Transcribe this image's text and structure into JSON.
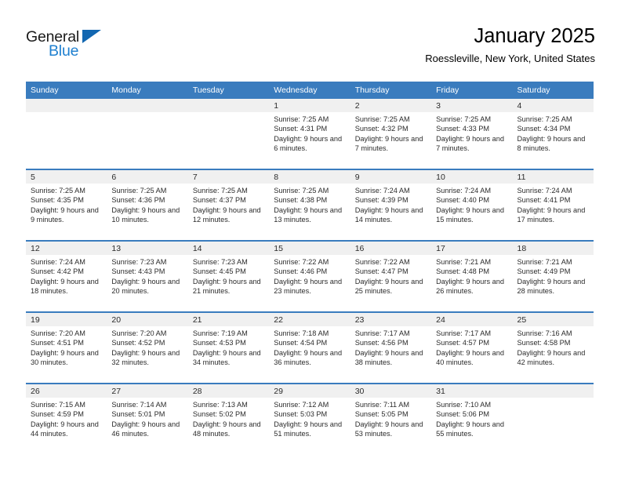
{
  "brand": {
    "name_part1": "General",
    "name_part2": "Blue",
    "triangle_icon": "triangle-icon",
    "accent_color": "#1f80d0",
    "triangle_color": "#1267b1"
  },
  "header": {
    "title": "January 2025",
    "subtitle": "Roessleville, New York, United States"
  },
  "theme": {
    "header_row_bg": "#3a7cbe",
    "daynum_band_bg": "#f0f0f0",
    "row_separator": "#3a7cbe",
    "text_color": "#2b2b2b"
  },
  "weekday_headers": [
    "Sunday",
    "Monday",
    "Tuesday",
    "Wednesday",
    "Thursday",
    "Friday",
    "Saturday"
  ],
  "labels": {
    "sunrise_prefix": "Sunrise:",
    "sunset_prefix": "Sunset:",
    "daylight_prefix": "Daylight:"
  },
  "weeks": [
    [
      {
        "day": "",
        "sunrise": "",
        "sunset": "",
        "daylight": "",
        "empty": true
      },
      {
        "day": "",
        "sunrise": "",
        "sunset": "",
        "daylight": "",
        "empty": true
      },
      {
        "day": "",
        "sunrise": "",
        "sunset": "",
        "daylight": "",
        "empty": true
      },
      {
        "day": "1",
        "sunrise": "Sunrise: 7:25 AM",
        "sunset": "Sunset: 4:31 PM",
        "daylight": "Daylight: 9 hours and 6 minutes."
      },
      {
        "day": "2",
        "sunrise": "Sunrise: 7:25 AM",
        "sunset": "Sunset: 4:32 PM",
        "daylight": "Daylight: 9 hours and 7 minutes."
      },
      {
        "day": "3",
        "sunrise": "Sunrise: 7:25 AM",
        "sunset": "Sunset: 4:33 PM",
        "daylight": "Daylight: 9 hours and 7 minutes."
      },
      {
        "day": "4",
        "sunrise": "Sunrise: 7:25 AM",
        "sunset": "Sunset: 4:34 PM",
        "daylight": "Daylight: 9 hours and 8 minutes."
      }
    ],
    [
      {
        "day": "5",
        "sunrise": "Sunrise: 7:25 AM",
        "sunset": "Sunset: 4:35 PM",
        "daylight": "Daylight: 9 hours and 9 minutes."
      },
      {
        "day": "6",
        "sunrise": "Sunrise: 7:25 AM",
        "sunset": "Sunset: 4:36 PM",
        "daylight": "Daylight: 9 hours and 10 minutes."
      },
      {
        "day": "7",
        "sunrise": "Sunrise: 7:25 AM",
        "sunset": "Sunset: 4:37 PM",
        "daylight": "Daylight: 9 hours and 12 minutes."
      },
      {
        "day": "8",
        "sunrise": "Sunrise: 7:25 AM",
        "sunset": "Sunset: 4:38 PM",
        "daylight": "Daylight: 9 hours and 13 minutes."
      },
      {
        "day": "9",
        "sunrise": "Sunrise: 7:24 AM",
        "sunset": "Sunset: 4:39 PM",
        "daylight": "Daylight: 9 hours and 14 minutes."
      },
      {
        "day": "10",
        "sunrise": "Sunrise: 7:24 AM",
        "sunset": "Sunset: 4:40 PM",
        "daylight": "Daylight: 9 hours and 15 minutes."
      },
      {
        "day": "11",
        "sunrise": "Sunrise: 7:24 AM",
        "sunset": "Sunset: 4:41 PM",
        "daylight": "Daylight: 9 hours and 17 minutes."
      }
    ],
    [
      {
        "day": "12",
        "sunrise": "Sunrise: 7:24 AM",
        "sunset": "Sunset: 4:42 PM",
        "daylight": "Daylight: 9 hours and 18 minutes."
      },
      {
        "day": "13",
        "sunrise": "Sunrise: 7:23 AM",
        "sunset": "Sunset: 4:43 PM",
        "daylight": "Daylight: 9 hours and 20 minutes."
      },
      {
        "day": "14",
        "sunrise": "Sunrise: 7:23 AM",
        "sunset": "Sunset: 4:45 PM",
        "daylight": "Daylight: 9 hours and 21 minutes."
      },
      {
        "day": "15",
        "sunrise": "Sunrise: 7:22 AM",
        "sunset": "Sunset: 4:46 PM",
        "daylight": "Daylight: 9 hours and 23 minutes."
      },
      {
        "day": "16",
        "sunrise": "Sunrise: 7:22 AM",
        "sunset": "Sunset: 4:47 PM",
        "daylight": "Daylight: 9 hours and 25 minutes."
      },
      {
        "day": "17",
        "sunrise": "Sunrise: 7:21 AM",
        "sunset": "Sunset: 4:48 PM",
        "daylight": "Daylight: 9 hours and 26 minutes."
      },
      {
        "day": "18",
        "sunrise": "Sunrise: 7:21 AM",
        "sunset": "Sunset: 4:49 PM",
        "daylight": "Daylight: 9 hours and 28 minutes."
      }
    ],
    [
      {
        "day": "19",
        "sunrise": "Sunrise: 7:20 AM",
        "sunset": "Sunset: 4:51 PM",
        "daylight": "Daylight: 9 hours and 30 minutes."
      },
      {
        "day": "20",
        "sunrise": "Sunrise: 7:20 AM",
        "sunset": "Sunset: 4:52 PM",
        "daylight": "Daylight: 9 hours and 32 minutes."
      },
      {
        "day": "21",
        "sunrise": "Sunrise: 7:19 AM",
        "sunset": "Sunset: 4:53 PM",
        "daylight": "Daylight: 9 hours and 34 minutes."
      },
      {
        "day": "22",
        "sunrise": "Sunrise: 7:18 AM",
        "sunset": "Sunset: 4:54 PM",
        "daylight": "Daylight: 9 hours and 36 minutes."
      },
      {
        "day": "23",
        "sunrise": "Sunrise: 7:17 AM",
        "sunset": "Sunset: 4:56 PM",
        "daylight": "Daylight: 9 hours and 38 minutes."
      },
      {
        "day": "24",
        "sunrise": "Sunrise: 7:17 AM",
        "sunset": "Sunset: 4:57 PM",
        "daylight": "Daylight: 9 hours and 40 minutes."
      },
      {
        "day": "25",
        "sunrise": "Sunrise: 7:16 AM",
        "sunset": "Sunset: 4:58 PM",
        "daylight": "Daylight: 9 hours and 42 minutes."
      }
    ],
    [
      {
        "day": "26",
        "sunrise": "Sunrise: 7:15 AM",
        "sunset": "Sunset: 4:59 PM",
        "daylight": "Daylight: 9 hours and 44 minutes."
      },
      {
        "day": "27",
        "sunrise": "Sunrise: 7:14 AM",
        "sunset": "Sunset: 5:01 PM",
        "daylight": "Daylight: 9 hours and 46 minutes."
      },
      {
        "day": "28",
        "sunrise": "Sunrise: 7:13 AM",
        "sunset": "Sunset: 5:02 PM",
        "daylight": "Daylight: 9 hours and 48 minutes."
      },
      {
        "day": "29",
        "sunrise": "Sunrise: 7:12 AM",
        "sunset": "Sunset: 5:03 PM",
        "daylight": "Daylight: 9 hours and 51 minutes."
      },
      {
        "day": "30",
        "sunrise": "Sunrise: 7:11 AM",
        "sunset": "Sunset: 5:05 PM",
        "daylight": "Daylight: 9 hours and 53 minutes."
      },
      {
        "day": "31",
        "sunrise": "Sunrise: 7:10 AM",
        "sunset": "Sunset: 5:06 PM",
        "daylight": "Daylight: 9 hours and 55 minutes."
      },
      {
        "day": "",
        "sunrise": "",
        "sunset": "",
        "daylight": "",
        "empty": true
      }
    ]
  ]
}
